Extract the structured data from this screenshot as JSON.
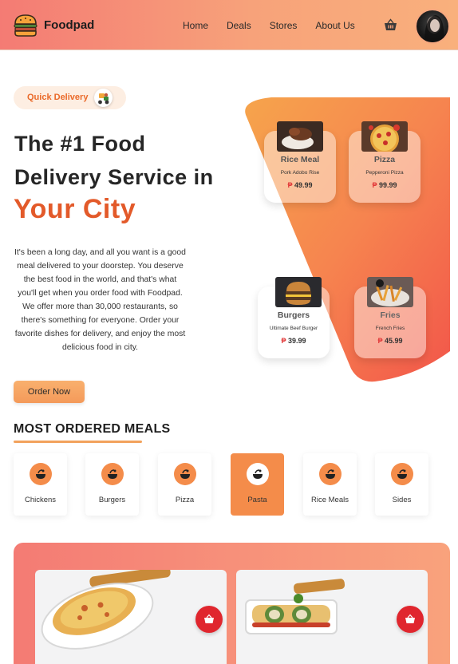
{
  "brand": {
    "name": "Foodpad"
  },
  "nav": {
    "links": [
      "Home",
      "Deals",
      "Stores",
      "About Us"
    ]
  },
  "hero": {
    "badge": "Quick Delivery",
    "title_line1": "The #1 Food",
    "title_line2": "Delivery Service in",
    "title_accent": "Your City",
    "description": "It's been a long day, and all you want is a good meal delivered to your doorstep. You deserve the best food in the world, and that's what you'll get when you order food with Foodpad. We offer more than 30,000 restaurants, so there's something for everyone. Order your favorite dishes for delivery, and enjoy the most delicious food in city.",
    "cta": "Order Now"
  },
  "featured": [
    {
      "name": "Rice Meal",
      "item": "Pork Adobo Rise",
      "currency": "₱",
      "price": "49.99"
    },
    {
      "name": "Pizza",
      "item": "Pepperoni Pizza",
      "currency": "₱",
      "price": "99.99"
    },
    {
      "name": "Burgers",
      "item": "Ultimate Beef Burger",
      "currency": "₱",
      "price": "39.99"
    },
    {
      "name": "Fries",
      "item": "French Fries",
      "currency": "₱",
      "price": "45.99"
    }
  ],
  "most_ordered": {
    "title": "MOST ORDERED MEALS",
    "categories": [
      "Chickens",
      "Burgers",
      "Pizza",
      "Pasta",
      "Rice Meals",
      "Sides"
    ],
    "active": "Pasta"
  },
  "colors": {
    "accent": "#e35a2a",
    "orange": "#f48c4a",
    "nav_start": "#f47b74",
    "nav_end": "#f9b07c",
    "cart_button": "#e0262e"
  },
  "icons": {
    "logo": "burger-logo-icon",
    "cart": "basket-icon",
    "category": "food-bowl-icon",
    "add": "basket-add-icon"
  }
}
